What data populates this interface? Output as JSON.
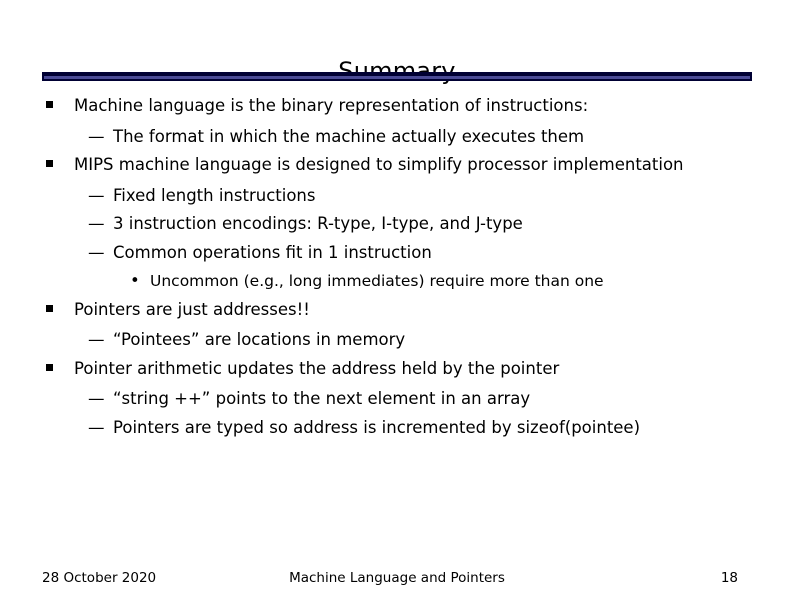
{
  "slide": {
    "title": "Summary",
    "accent_color": "#000033",
    "accent_inner_color": "#4b4b96",
    "background_color": "#ffffff",
    "text_color": "#000000"
  },
  "bullets": [
    {
      "level": 1,
      "marker": "square-bullet",
      "marker_glyph": "",
      "text": "Machine language is the binary representation of instructions:"
    },
    {
      "level": 2,
      "marker": "en-dash-bullet",
      "marker_glyph": "—",
      "text": "The format in which the machine actually executes them"
    },
    {
      "level": 1,
      "marker": "square-bullet",
      "marker_glyph": "",
      "text": "MIPS machine language is designed to simplify processor implementation"
    },
    {
      "level": 2,
      "marker": "en-dash-bullet",
      "marker_glyph": "—",
      "text": "Fixed length instructions"
    },
    {
      "level": 2,
      "marker": "en-dash-bullet",
      "marker_glyph": "—",
      "text": "3 instruction encodings: R-type, I-type, and J-type"
    },
    {
      "level": 2,
      "marker": "en-dash-bullet",
      "marker_glyph": "—",
      "text": "Common operations fit in 1 instruction"
    },
    {
      "level": 3,
      "marker": "round-bullet",
      "marker_glyph": "•",
      "text": "Uncommon (e.g., long immediates) require more than one"
    },
    {
      "level": 1,
      "marker": "square-bullet",
      "marker_glyph": "",
      "text": "Pointers are just addresses!!"
    },
    {
      "level": 2,
      "marker": "en-dash-bullet",
      "marker_glyph": "—",
      "text": "“Pointees” are locations in memory"
    },
    {
      "level": 1,
      "marker": "square-bullet",
      "marker_glyph": "",
      "text": "Pointer arithmetic updates the address held by the pointer"
    },
    {
      "level": 2,
      "marker": "en-dash-bullet",
      "marker_glyph": "—",
      "text": "“string ++” points to the next element in an array"
    },
    {
      "level": 2,
      "marker": "en-dash-bullet",
      "marker_glyph": "—",
      "text": "Pointers are typed so address is incremented by sizeof(pointee)"
    }
  ],
  "footer": {
    "date": "28 October 2020",
    "center": "Machine Language and Pointers",
    "page_number": "18"
  }
}
